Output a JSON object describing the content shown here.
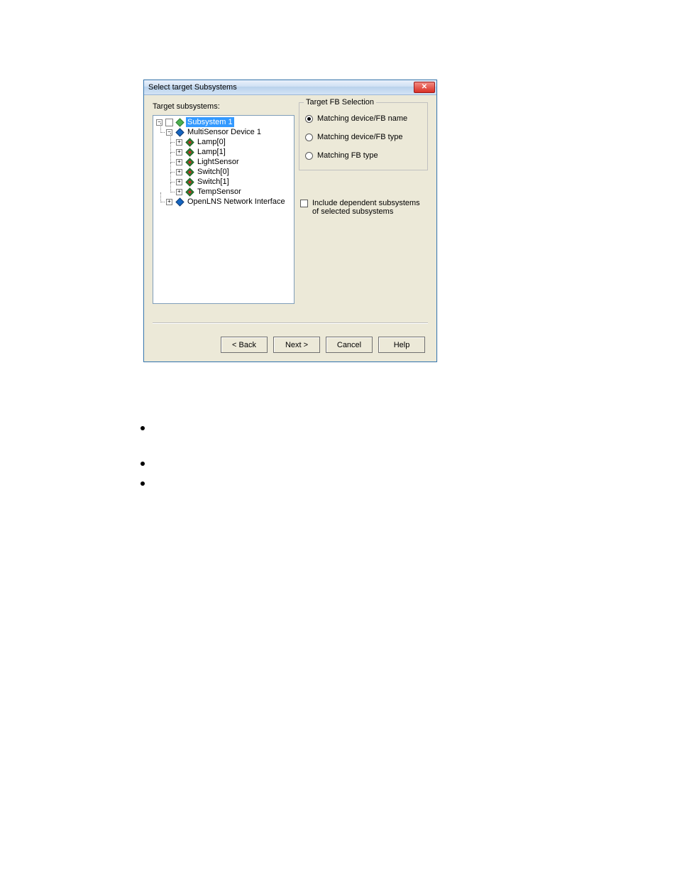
{
  "dialog": {
    "title": "Select target Subsystems",
    "label_target_subsystems": "Target subsystems:",
    "tree": {
      "root": {
        "label": "Subsystem 1",
        "children": [
          {
            "label": "MultiSensor Device 1",
            "children": [
              {
                "label": "Lamp[0]"
              },
              {
                "label": "Lamp[1]"
              },
              {
                "label": "LightSensor"
              },
              {
                "label": "Switch[0]"
              },
              {
                "label": "Switch[1]"
              },
              {
                "label": "TempSensor"
              }
            ]
          },
          {
            "label": "OpenLNS Network Interface"
          }
        ]
      }
    },
    "fb_selection": {
      "legend": "Target FB Selection",
      "opt_name": "Matching device/FB name",
      "opt_devtype": "Matching device/FB type",
      "opt_fbtype": "Matching FB type",
      "selected": "name"
    },
    "include_dependent": {
      "label": "Include dependent subsystems of selected subsystems",
      "checked": false
    },
    "buttons": {
      "back": "< Back",
      "next": "Next >",
      "cancel": "Cancel",
      "help": "Help"
    }
  }
}
